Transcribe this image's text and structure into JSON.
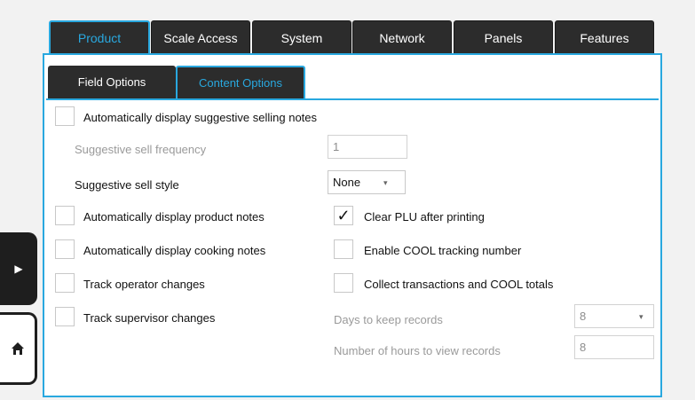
{
  "top_tabs": [
    {
      "label": "Product",
      "active": true
    },
    {
      "label": "Scale Access",
      "active": false
    },
    {
      "label": "System",
      "active": false
    },
    {
      "label": "Network",
      "active": false
    },
    {
      "label": "Panels",
      "active": false
    },
    {
      "label": "Features",
      "active": false
    }
  ],
  "sub_tabs": [
    {
      "label": "Field Options",
      "active": false
    },
    {
      "label": "Content Options",
      "active": true
    }
  ],
  "options": {
    "auto_suggestive": {
      "label": "Automatically display suggestive selling notes",
      "checked": false
    },
    "suggestive_frequency": {
      "label": "Suggestive sell frequency",
      "value": "1"
    },
    "suggestive_style": {
      "label": "Suggestive sell style",
      "value": "None"
    },
    "auto_product_notes": {
      "label": "Automatically display product notes",
      "checked": false
    },
    "auto_cooking_notes": {
      "label": "Automatically display cooking notes",
      "checked": false
    },
    "track_operator": {
      "label": "Track operator changes",
      "checked": false
    },
    "track_supervisor": {
      "label": "Track supervisor changes",
      "checked": false
    },
    "clear_plu": {
      "label": "Clear PLU after printing",
      "checked": true,
      "mark": "✓"
    },
    "enable_cool": {
      "label": "Enable COOL tracking number",
      "checked": false
    },
    "collect_cool": {
      "label": "Collect transactions and COOL totals",
      "checked": false
    },
    "days_keep": {
      "label": "Days to keep records",
      "value": "8"
    },
    "hours_view": {
      "label": "Number of hours to view records",
      "value": "8"
    }
  },
  "side": {
    "arrow_icon": "▶",
    "home_icon": "home"
  },
  "colors": {
    "accent": "#29a8df",
    "tab_bg": "#2c2c2c"
  }
}
